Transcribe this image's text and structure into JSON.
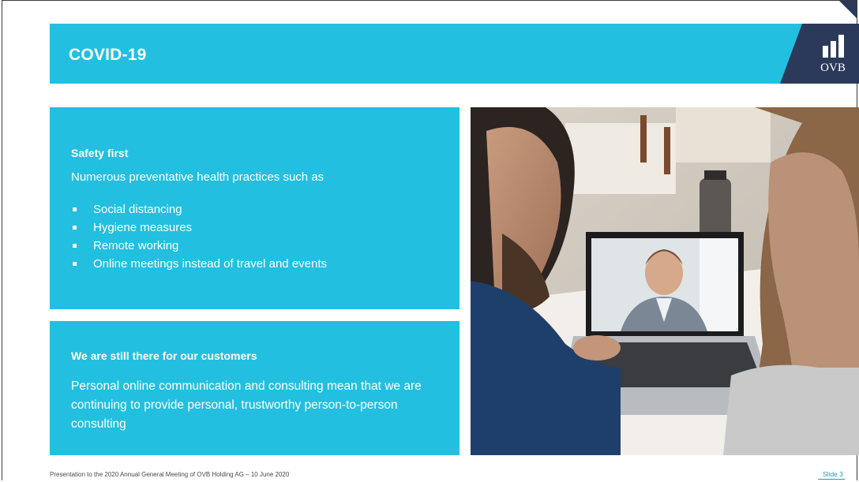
{
  "slide": {
    "title": "COVID-19",
    "logo_text": "OVB",
    "panels": [
      {
        "heading": "Safety first",
        "intro": "Numerous preventative health practices such as",
        "bullets": [
          "Social distancing",
          "Hygiene measures",
          "Remote working",
          "Online meetings instead of travel and events"
        ]
      },
      {
        "heading": "We are still there for our customers",
        "body": "Personal online communication and consulting mean that we are continuing to provide personal, trustworthy person-to-person consulting"
      }
    ],
    "footer": "Presentation to the 2020 Annual General Meeting of OVB Holding AG – 10 June 2020",
    "slide_number": "Slide  3"
  },
  "colors": {
    "accent": "#23bfe0",
    "logo_navy": "#2b3a5a",
    "text_on_accent": "#ffffff"
  },
  "icons": {
    "logo": "ovb-bar-chart-logo"
  }
}
